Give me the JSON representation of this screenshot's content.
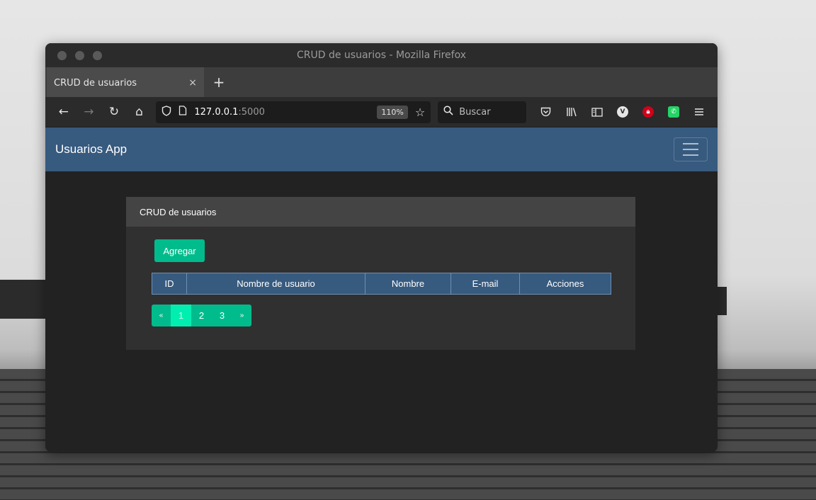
{
  "window": {
    "title": "CRUD de usuarios - Mozilla Firefox"
  },
  "tab": {
    "title": "CRUD de usuarios",
    "close": "×",
    "new": "+"
  },
  "toolbar": {
    "back": "←",
    "forward": "→",
    "reload": "↻",
    "home": "⌂",
    "url_host": "127.0.0.1",
    "url_port": ":5000",
    "zoom": "110%",
    "search_placeholder": "Buscar"
  },
  "navbar": {
    "brand": "Usuarios App"
  },
  "card": {
    "header": "CRUD de usuarios",
    "add_button": "Agregar",
    "table_headers": [
      "ID",
      "Nombre de usuario",
      "Nombre",
      "E-mail",
      "Acciones"
    ]
  },
  "pagination": {
    "prev": "«",
    "pages": [
      "1",
      "2",
      "3"
    ],
    "active_page": "1",
    "next": "»"
  },
  "colors": {
    "navbar": "#375a7f",
    "success": "#00bc8c",
    "background": "#222222",
    "card": "#303030"
  }
}
